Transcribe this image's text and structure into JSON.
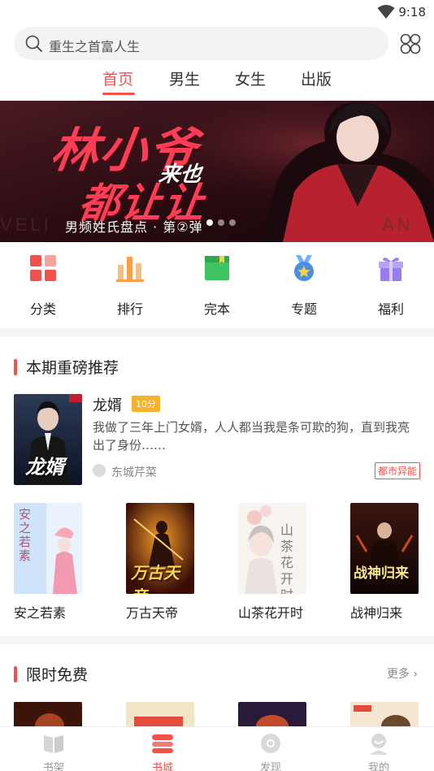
{
  "status_bar": {
    "time": "9:18"
  },
  "search": {
    "placeholder": "重生之首富人生"
  },
  "tabs": [
    {
      "label": "首页",
      "active": true
    },
    {
      "label": "男生",
      "active": false
    },
    {
      "label": "女生",
      "active": false
    },
    {
      "label": "出版",
      "active": false
    }
  ],
  "banner": {
    "headline_1": "林小爷",
    "headline_2": "来也",
    "headline_3": "都让让",
    "subtitle": "男频姓氏盘点 · 第②弹",
    "slide_count": 3,
    "active_slide": 1
  },
  "categories": [
    {
      "label": "分类",
      "icon": "grid-icon",
      "color": "#f0524c"
    },
    {
      "label": "排行",
      "icon": "bar-chart-icon",
      "color": "#f7a24b"
    },
    {
      "label": "完本",
      "icon": "book-icon",
      "color": "#3fc563"
    },
    {
      "label": "专题",
      "icon": "medal-icon",
      "color": "#4a90e2"
    },
    {
      "label": "福利",
      "icon": "gift-icon",
      "color": "#9b7cf0"
    }
  ],
  "featured_section": {
    "title": "本期重磅推荐",
    "book": {
      "title": "龙婿",
      "score": "10分",
      "description": "我做了三年上门女婿，人人都当我是条可欺的狗，直到我亮出了身份……",
      "author": "东城芹菜",
      "genre": "都市异能",
      "cover_text": "龙婿"
    },
    "grid": [
      {
        "title": "安之若素",
        "cover_text": "安之若素"
      },
      {
        "title": "万古天帝",
        "cover_text": "万古天帝"
      },
      {
        "title": "山茶花开时",
        "cover_text": "山茶花开时"
      },
      {
        "title": "战神归来",
        "cover_text": "战神归来"
      }
    ]
  },
  "free_section": {
    "title": "限时免费",
    "more_label": "更多"
  },
  "bottom_nav": [
    {
      "label": "书架",
      "icon": "bookshelf-icon",
      "active": false
    },
    {
      "label": "书城",
      "icon": "bookstore-icon",
      "active": true
    },
    {
      "label": "发现",
      "icon": "discover-icon",
      "active": false
    },
    {
      "label": "我的",
      "icon": "profile-icon",
      "active": false
    }
  ],
  "colors": {
    "accent": "#f0524c",
    "score_badge": "#f5b22b"
  }
}
